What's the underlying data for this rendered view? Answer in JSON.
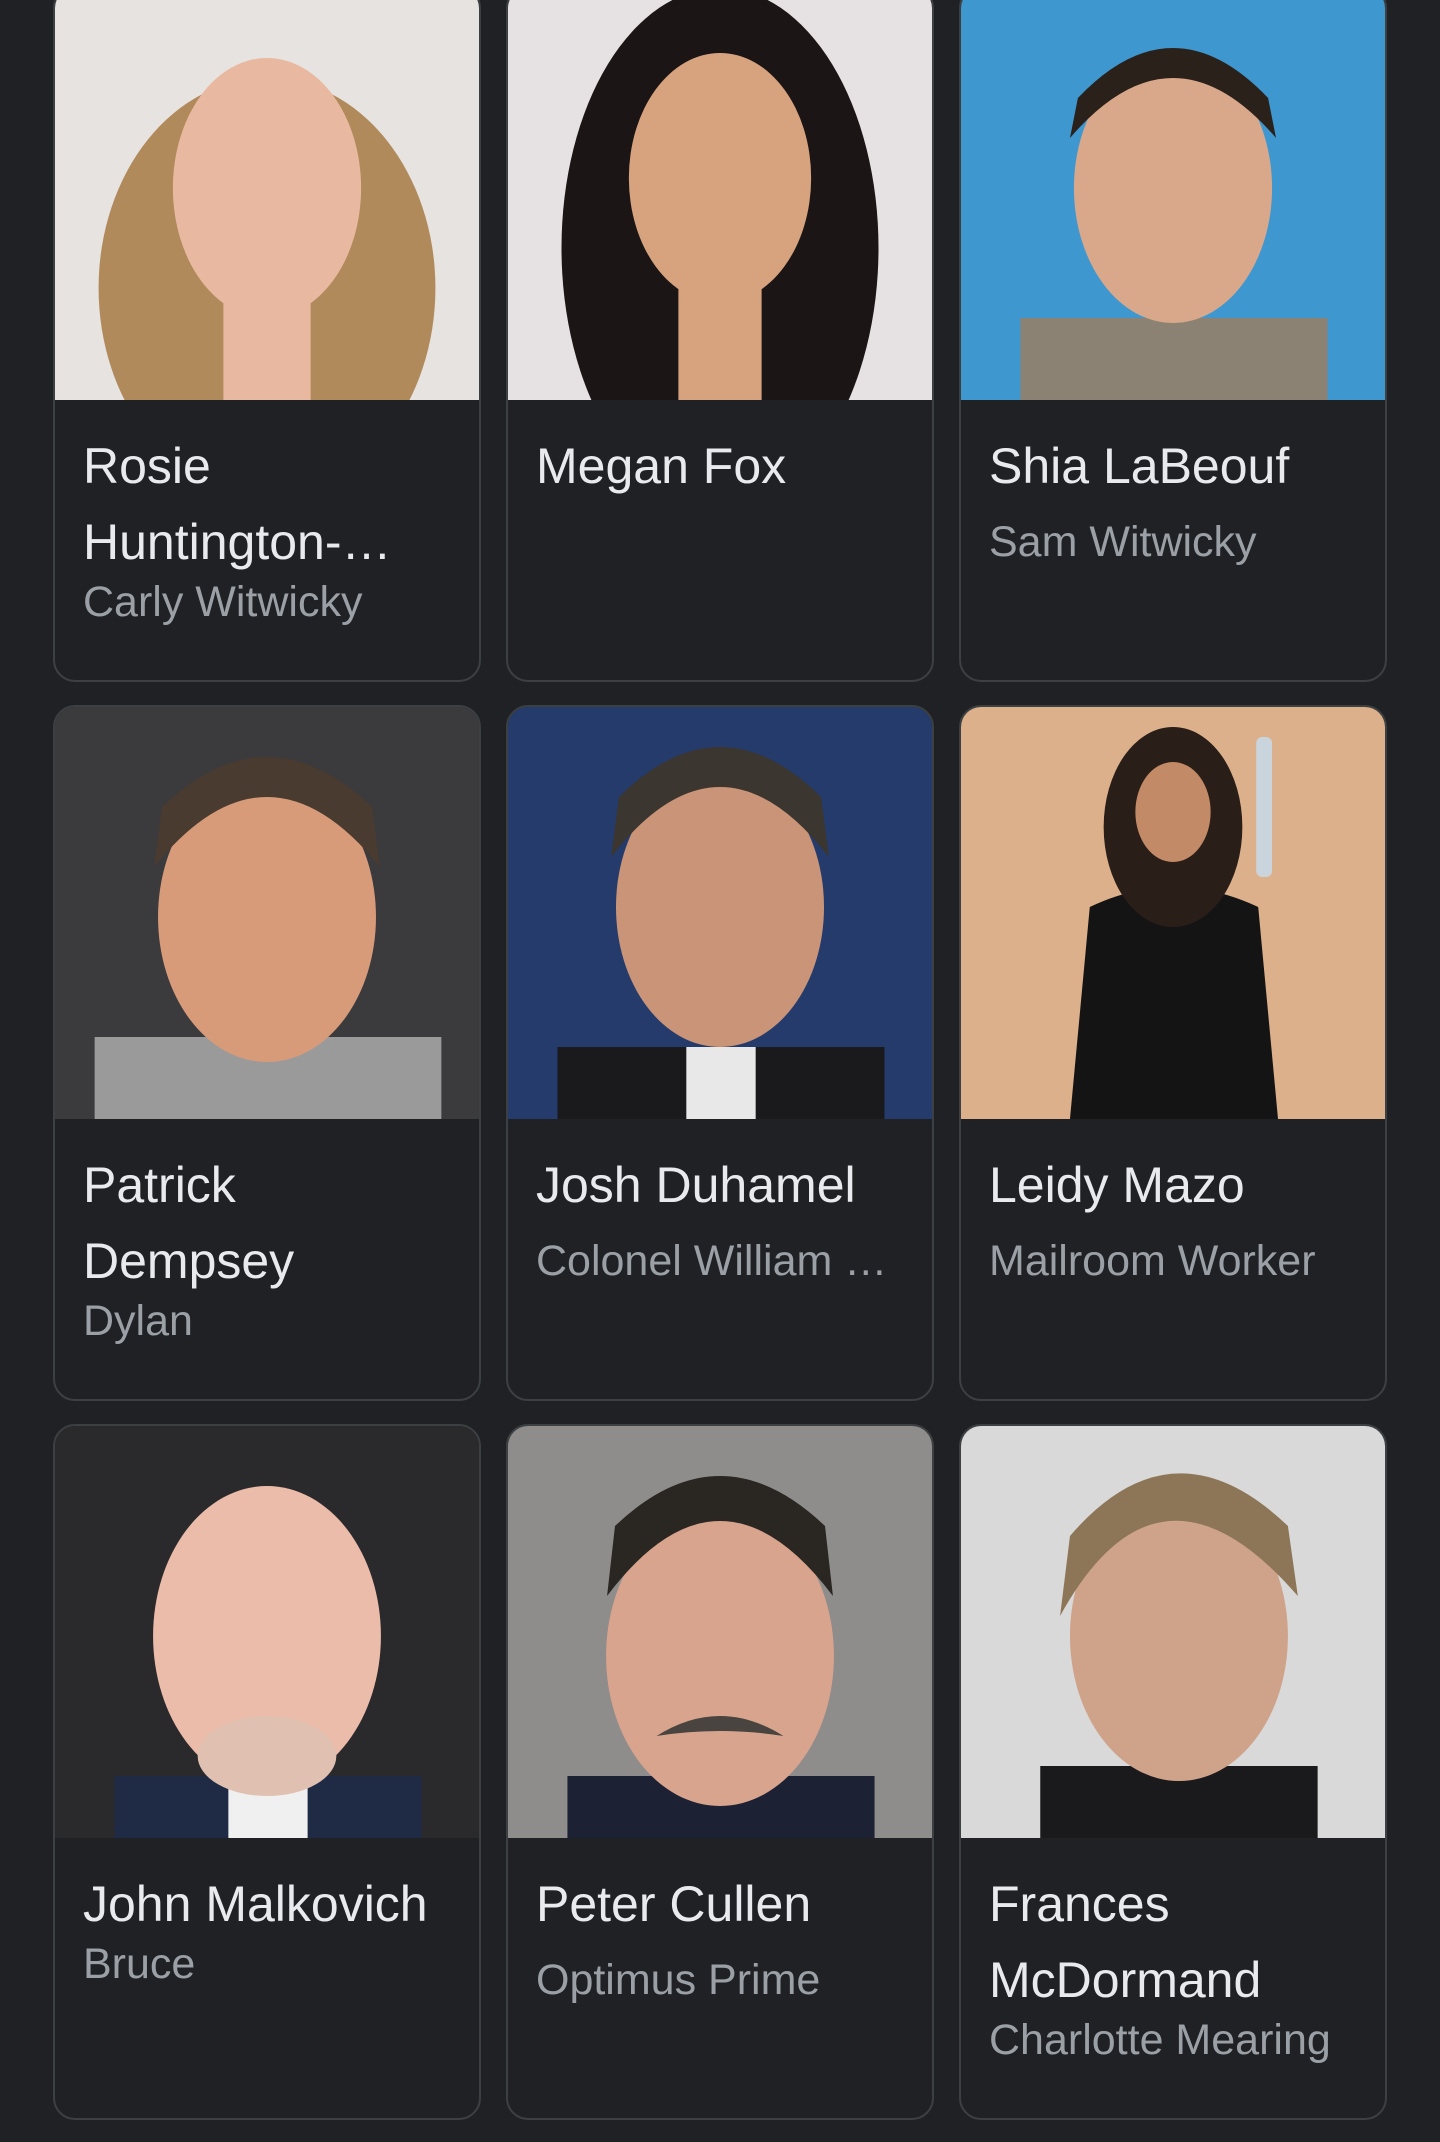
{
  "cast": [
    {
      "name": "Rosie Huntington-Whiteley",
      "role": "Carly Witwicky",
      "photo_bg": "#e7e3e0",
      "skin": "#e8b9a0",
      "hair": "#b08a5a"
    },
    {
      "name": "Megan Fox",
      "role": "",
      "photo_bg": "#e6e1e3",
      "skin": "#d7a37f",
      "hair": "#1b1515"
    },
    {
      "name": "Shia LaBeouf",
      "role": "Sam Witwicky",
      "photo_bg": "#3f97cf",
      "skin": "#d9a88b",
      "hair": "#2a211b"
    },
    {
      "name": "Patrick Dempsey",
      "role": "Dylan",
      "photo_bg": "#3b3a3d",
      "skin": "#d79b7a",
      "hair": "#4a3b30"
    },
    {
      "name": "Josh Duhamel",
      "role": "Colonel William Lennox",
      "photo_bg": "#243b6b",
      "skin": "#c99477",
      "hair": "#3b3630"
    },
    {
      "name": "Leidy Mazo",
      "role": "Mailroom Worker",
      "photo_bg": "#dcb08a",
      "skin": "#c28a66",
      "hair": "#2a1e19"
    },
    {
      "name": "John Malkovich",
      "role": "Bruce",
      "photo_bg": "#2a2a2d",
      "skin": "#ecbcaa",
      "hair": "#e0c0b0"
    },
    {
      "name": "Peter Cullen",
      "role": "Optimus Prime",
      "photo_bg": "#8f8d8c",
      "skin": "#d9a48d",
      "hair": "#2a2622"
    },
    {
      "name": "Frances McDormand",
      "role": "Charlotte Mearing",
      "photo_bg": "#d9d9d9",
      "skin": "#cfa38a",
      "hair": "#8d7657"
    }
  ]
}
